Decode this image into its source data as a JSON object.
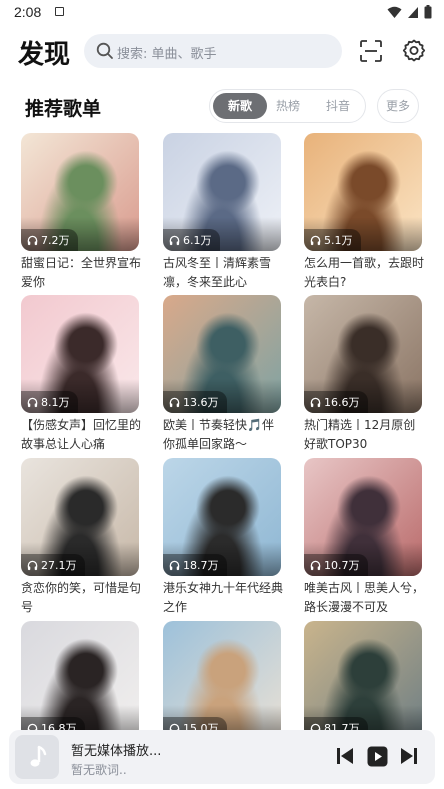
{
  "status": {
    "time": "2:08"
  },
  "header": {
    "brand": "发现",
    "search_placeholder": "搜索: 单曲、歌手"
  },
  "section": {
    "title": "推荐歌单",
    "tabs": [
      {
        "label": "新歌",
        "active": true
      },
      {
        "label": "热榜",
        "active": false
      },
      {
        "label": "抖音",
        "active": false
      }
    ],
    "more_label": "更多"
  },
  "playlists": [
    {
      "plays": "7.2万",
      "title": "甜蜜日记：全世界宣布爱你",
      "palette": [
        "#f3e6d6",
        "#d99b8e",
        "#6b8f5e"
      ]
    },
    {
      "plays": "6.1万",
      "title": "古风冬至丨清辉素雪凛，冬来至此心",
      "palette": [
        "#c9d2e3",
        "#eef1f7",
        "#5b6a86"
      ]
    },
    {
      "plays": "5.1万",
      "title": "怎么用一首歌，去跟时光表白?",
      "palette": [
        "#e8b27a",
        "#fbe4c4",
        "#7a4a2a"
      ]
    },
    {
      "plays": "8.1万",
      "title": "【伤感女声】回忆里的故事总让人心痛",
      "palette": [
        "#f2c9cf",
        "#fae8ea",
        "#3b2a2a"
      ]
    },
    {
      "plays": "13.6万",
      "title": "欧美丨节奏轻快🎵伴你孤单回家路～",
      "palette": [
        "#d9a98a",
        "#7fa3a3",
        "#3e5f63"
      ]
    },
    {
      "plays": "16.6万",
      "title": "热门精选丨12月原创好歌TOP30",
      "palette": [
        "#c6b7a8",
        "#8a7464",
        "#3a2e28"
      ]
    },
    {
      "plays": "27.1万",
      "title": "贪恋你的笑，可惜是句号",
      "palette": [
        "#e9e4de",
        "#c7b8a8",
        "#2a2a2a"
      ]
    },
    {
      "plays": "18.7万",
      "title": "港乐女神九十年代经典之作",
      "palette": [
        "#bcd6e8",
        "#8fb7d3",
        "#2b2b2b"
      ]
    },
    {
      "plays": "10.7万",
      "title": "唯美古风丨思美人兮，路长漫漫不可及",
      "palette": [
        "#e8c6c6",
        "#b96a6a",
        "#40303a"
      ]
    },
    {
      "plays": "16.8万",
      "title": "",
      "palette": [
        "#d9d9de",
        "#f1efee",
        "#2a2424"
      ]
    },
    {
      "plays": "15.0万",
      "title": "",
      "palette": [
        "#9dc1da",
        "#e8e0d5",
        "#c9a27c"
      ]
    },
    {
      "plays": "81.7万",
      "title": "",
      "palette": [
        "#c9b48c",
        "#6f7f84",
        "#2d3f3a"
      ]
    }
  ],
  "player": {
    "title": "暂无媒体播放...",
    "subtitle": "暂无歌词.."
  }
}
